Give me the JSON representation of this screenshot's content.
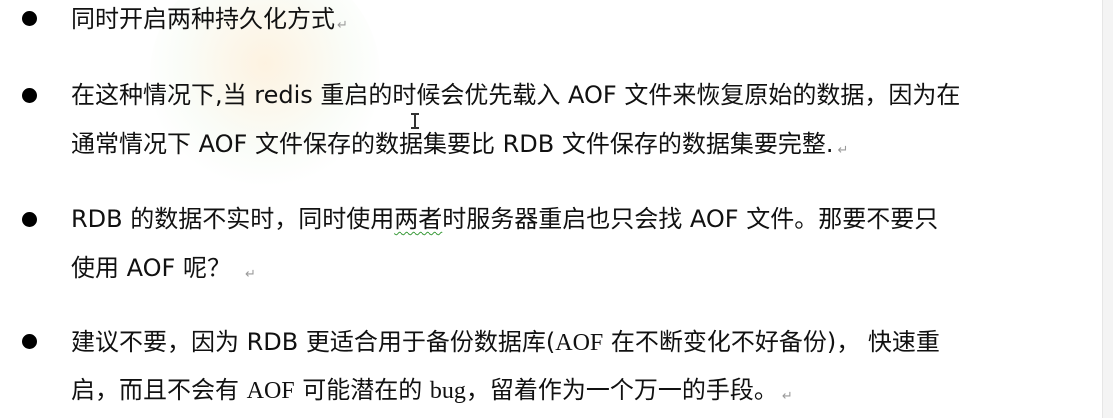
{
  "bullets": [
    {
      "lines": [
        "同时开启两种持久化方式"
      ]
    },
    {
      "lines": [
        "在这种情况下,当 redis 重启的时候会优先载入 AOF 文件来恢复原始的数据，因为在",
        "通常情况下 AOF 文件保存的数据集要比 RDB 文件保存的数据集要完整."
      ]
    },
    {
      "lines": [
        "RDB 的数据不实时，同时使用",
        "两者",
        "时服务器重启也只会找 AOF 文件。那要不要只",
        "使用 AOF 呢？"
      ]
    },
    {
      "lines": [
        "建议不要，因为 RDB 更适合用于备份数据库(",
        "AOF",
        " 在不断变化不好备份)， 快速重",
        "启，而且不会有 ",
        "AOF",
        " 可能潜在的 ",
        "bug",
        "，留着作为一个万一的手段。"
      ]
    }
  ],
  "paragraph_mark": "↵"
}
